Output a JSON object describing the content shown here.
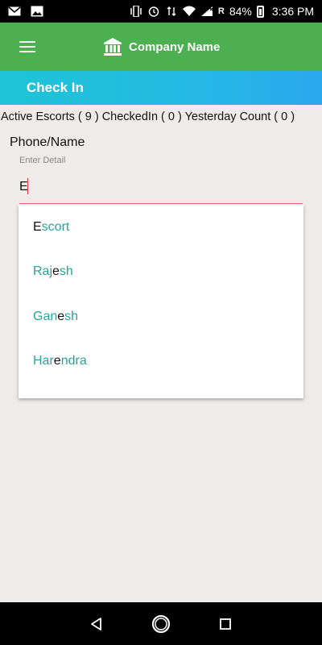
{
  "status_bar": {
    "battery": "84%",
    "time": "3:36 PM",
    "roaming": "R",
    "icons": [
      "gmail-icon",
      "image-icon",
      "vibrate-icon",
      "alarm-icon",
      "wifi-icon",
      "signal-icon",
      "battery-icon"
    ]
  },
  "app_bar": {
    "title": "Company Name",
    "menu_icon": "hamburger-menu-icon",
    "logo_icon": "bank-building-icon",
    "color": "#4caf50"
  },
  "section": {
    "title": "Check In"
  },
  "stats": {
    "text": "Active Escorts ( 9 ) CheckedIn ( 0 ) Yesterday Count ( 0 )"
  },
  "search": {
    "label": "Phone/Name",
    "hint": "Enter Detail",
    "value": "E"
  },
  "suggestions": [
    {
      "parts": [
        {
          "t": "E",
          "hl": true
        },
        {
          "t": "scort",
          "hl": false
        }
      ]
    },
    {
      "parts": [
        {
          "t": "Raj",
          "hl": false
        },
        {
          "t": "e",
          "hl": true
        },
        {
          "t": "sh",
          "hl": false
        }
      ]
    },
    {
      "parts": [
        {
          "t": "Gan",
          "hl": false
        },
        {
          "t": "e",
          "hl": true
        },
        {
          "t": "sh",
          "hl": false
        }
      ]
    },
    {
      "parts": [
        {
          "t": "Har",
          "hl": false
        },
        {
          "t": "e",
          "hl": true
        },
        {
          "t": "ndra",
          "hl": false
        }
      ]
    }
  ],
  "colors": {
    "accent_teal": "#26a69a",
    "header_gradient_start": "#1ec5d6",
    "header_gradient_end": "#2aa7ef",
    "background": "#efebe9"
  },
  "nav_bar": {
    "icons": [
      "back-icon",
      "home-icon",
      "recents-icon"
    ]
  }
}
